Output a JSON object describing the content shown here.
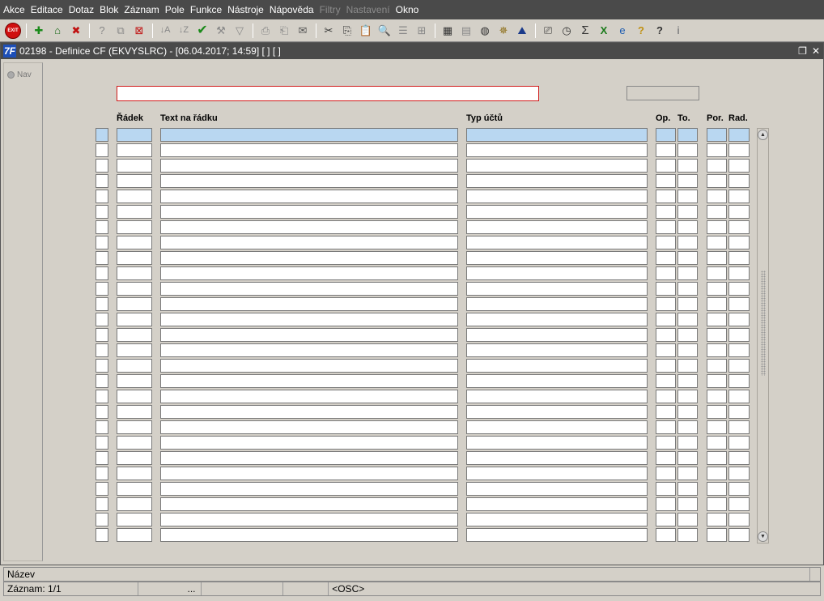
{
  "menu": [
    {
      "label": "Akce",
      "disabled": false
    },
    {
      "label": "Editace",
      "disabled": false
    },
    {
      "label": "Dotaz",
      "disabled": false
    },
    {
      "label": "Blok",
      "disabled": false
    },
    {
      "label": "Záznam",
      "disabled": false
    },
    {
      "label": "Pole",
      "disabled": false
    },
    {
      "label": "Funkce",
      "disabled": false
    },
    {
      "label": "Nástroje",
      "disabled": false
    },
    {
      "label": "Nápověda",
      "disabled": false
    },
    {
      "label": "Filtry",
      "disabled": true
    },
    {
      "label": "Nastavení",
      "disabled": true
    },
    {
      "label": "Okno",
      "disabled": false
    }
  ],
  "toolbar": {
    "exit_label": "EXIT"
  },
  "window": {
    "title": "02198 - Definice CF (EKVYSLRC) - [06.04.2017; 14:59]  [ ]  [ ]",
    "app_icon": "7F"
  },
  "nav": {
    "label": "Nav"
  },
  "columns": {
    "radek": "Řádek",
    "text": "Text na řádku",
    "typ": "Typ účtů",
    "op": "Op.",
    "to": "To.",
    "por": "Por.",
    "rad": "Rad."
  },
  "rows_count": 27,
  "status": {
    "label": "Název",
    "record": "Záznam: 1/1",
    "ellipsis": "...",
    "osc": "<OSC>"
  },
  "colors": {
    "menubar": "#4a4a4a",
    "selected_row": "#b9d7f1",
    "focus_border": "#d01a1a"
  }
}
